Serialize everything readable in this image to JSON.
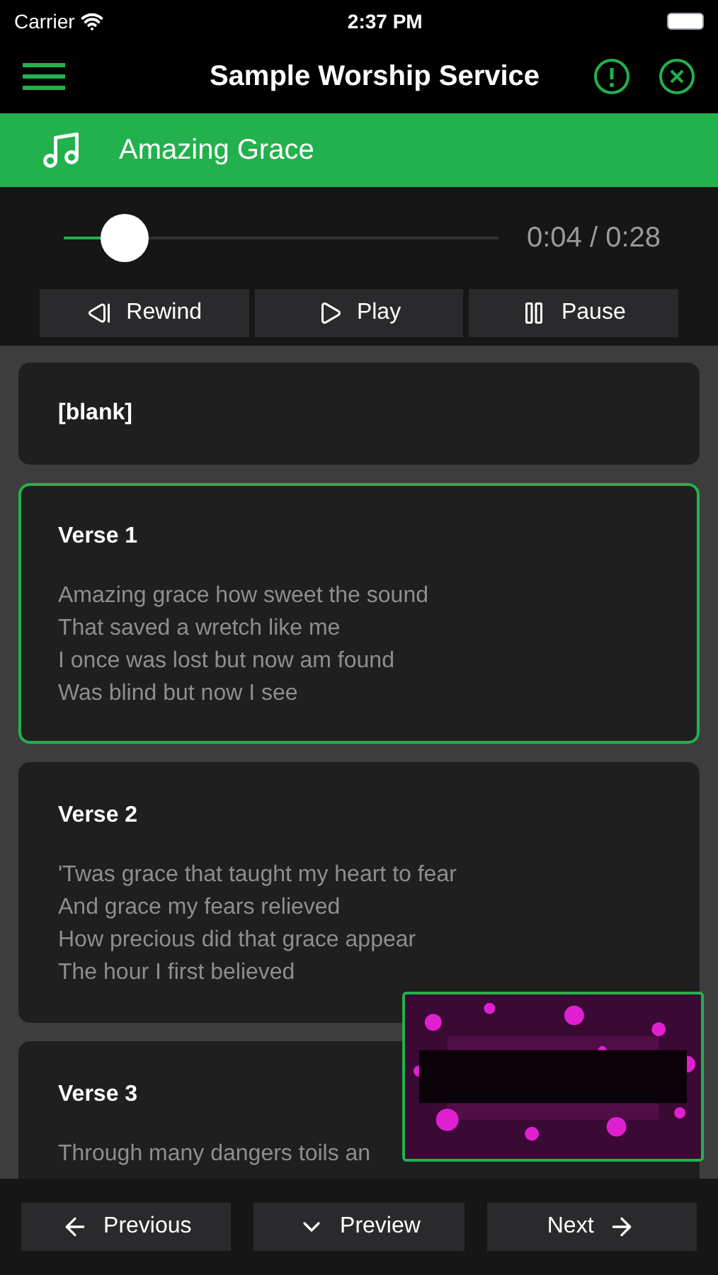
{
  "status_bar": {
    "carrier": "Carrier",
    "time": "2:37 PM"
  },
  "nav": {
    "title": "Sample Worship Service"
  },
  "song": {
    "title": "Amazing Grace"
  },
  "player": {
    "level": 0.14,
    "reading": "0:04 / 0:28",
    "buttons": [
      "Rewind",
      "Play",
      "Pause"
    ]
  },
  "slides": [
    {
      "title": "[blank]",
      "selected": false
    },
    {
      "title": "Verse 1",
      "lines": [
        "Amazing grace how sweet the sound",
        "That saved a wretch like me",
        "I once was lost but now am found",
        "Was blind but now I see"
      ],
      "selected": true
    },
    {
      "title": "Verse 2",
      "lines": [
        "'Twas grace that taught my heart to fear",
        "And grace my fears relieved",
        "How precious did that grace appear",
        "The hour I first believed"
      ],
      "selected": false
    },
    {
      "title": "Verse 3",
      "lines": [
        "Through many dangers toils an"
      ],
      "selected": false
    }
  ],
  "bottom_bar": {
    "previous": "Previous",
    "preview": "Preview",
    "next": "Next"
  }
}
